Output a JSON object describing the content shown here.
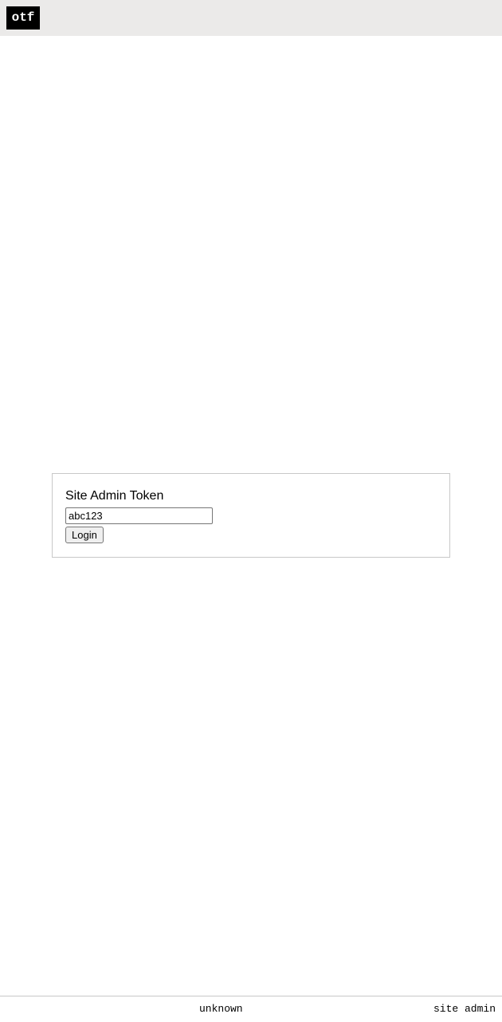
{
  "header": {
    "logo_text": "otf"
  },
  "login": {
    "title": "Site Admin Token",
    "token_value": "abc123",
    "button_label": "Login"
  },
  "footer": {
    "status": "unknown",
    "role": "site admin"
  },
  "colors": {
    "topbar_background": "#ebeae9",
    "logo_background": "#000000",
    "logo_text": "#ffffff",
    "panel_border": "#c8c8c8"
  }
}
